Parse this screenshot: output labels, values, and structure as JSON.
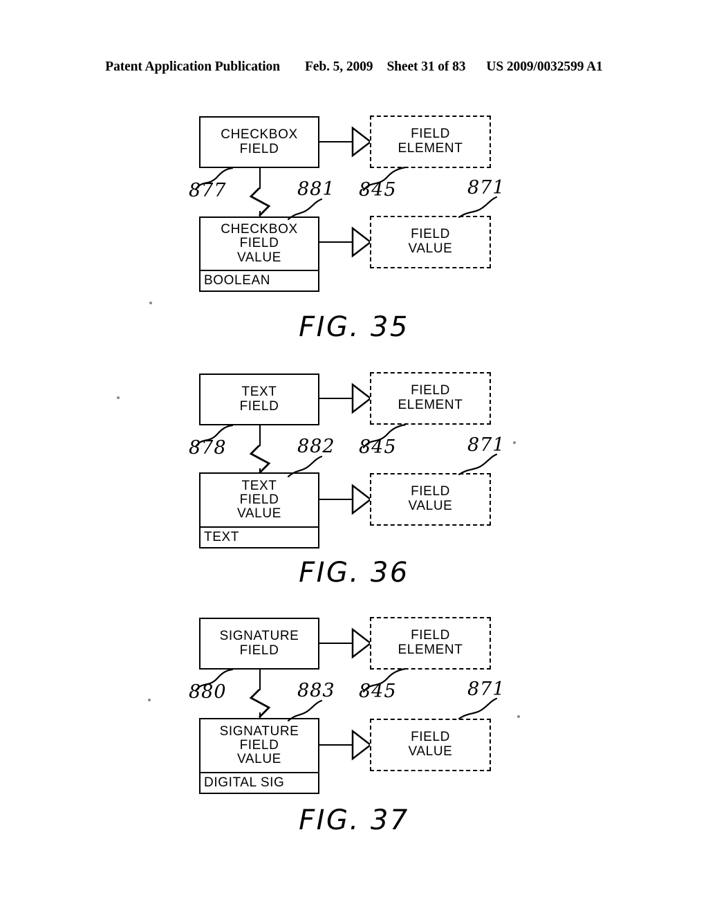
{
  "header": {
    "publication": "Patent Application Publication",
    "date": "Feb. 5, 2009",
    "sheet": "Sheet 31 of 83",
    "patent_number": "US 2009/0032599 A1"
  },
  "figures": [
    {
      "caption": "FIG. 35",
      "field_box": {
        "title": "CHECKBOX\nFIELD",
        "ref": "877"
      },
      "value_box": {
        "title": "CHECKBOX\nFIELD\nVALUE",
        "type": "BOOLEAN",
        "ref": "881"
      },
      "element_ref_box": {
        "label": "FIELD\nELEMENT",
        "ref": "845"
      },
      "value_ref_box": {
        "label": "FIELD\nVALUE",
        "ref": "871"
      }
    },
    {
      "caption": "FIG. 36",
      "field_box": {
        "title": "TEXT\nFIELD",
        "ref": "878"
      },
      "value_box": {
        "title": "TEXT\nFIELD\nVALUE",
        "type": "TEXT",
        "ref": "882"
      },
      "element_ref_box": {
        "label": "FIELD\nELEMENT",
        "ref": "845"
      },
      "value_ref_box": {
        "label": "FIELD\nVALUE",
        "ref": "871"
      }
    },
    {
      "caption": "FIG. 37",
      "field_box": {
        "title": "SIGNATURE\nFIELD",
        "ref": "880"
      },
      "value_box": {
        "title": "SIGNATURE\nFIELD\nVALUE",
        "type": "DIGITAL SIG",
        "ref": "883"
      },
      "element_ref_box": {
        "label": "FIELD\nELEMENT",
        "ref": "845"
      },
      "value_ref_box": {
        "label": "FIELD\nVALUE",
        "ref": "871"
      }
    }
  ]
}
